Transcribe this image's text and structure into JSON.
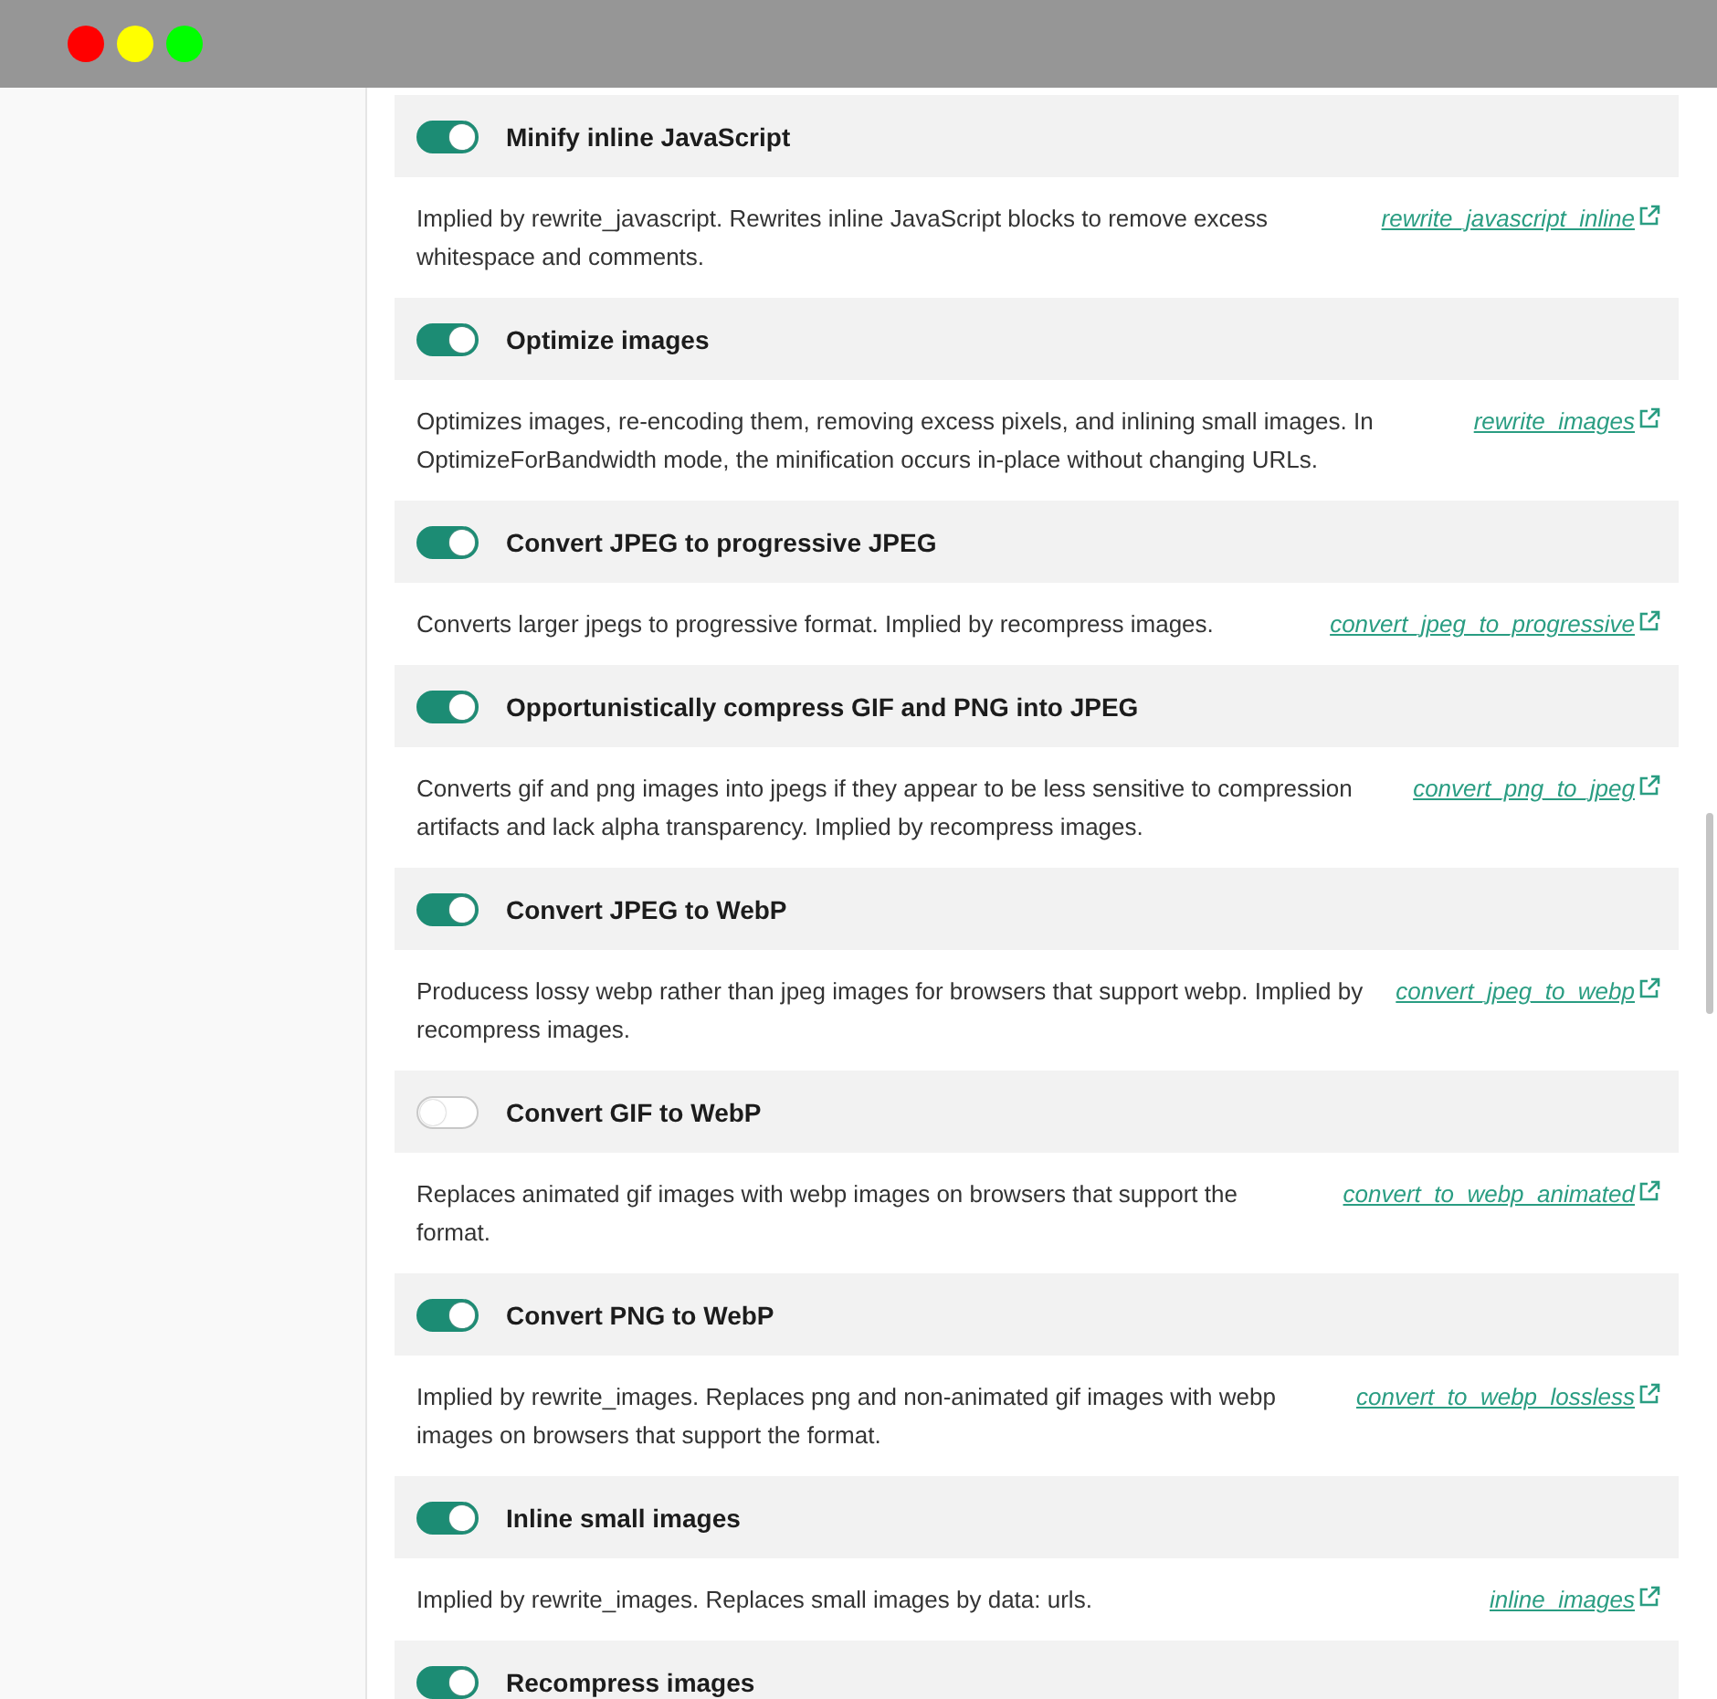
{
  "window": {
    "controls": [
      {
        "color": "#ff0000"
      },
      {
        "color": "#ffff00"
      },
      {
        "color": "#00ff00"
      }
    ]
  },
  "settings": [
    {
      "title": "Minify inline JavaScript",
      "on": true,
      "description": "Implied by rewrite_javascript. Rewrites inline JavaScript blocks to remove excess whitespace and comments.",
      "link": "rewrite_javascript_inline"
    },
    {
      "title": "Optimize images",
      "on": true,
      "description": "Optimizes images, re-encoding them, removing excess pixels, and inlining small images. In OptimizeForBandwidth mode, the minification occurs in-place without changing URLs.",
      "link": "rewrite_images"
    },
    {
      "title": "Convert JPEG to progressive JPEG",
      "on": true,
      "description": "Converts larger jpegs to progressive format. Implied by recompress images.",
      "link": "convert_jpeg_to_progressive"
    },
    {
      "title": "Opportunistically compress GIF and PNG into JPEG",
      "on": true,
      "description": "Converts gif and png images into jpegs if they appear to be less sensitive to compression artifacts and lack alpha transparency. Implied by recompress images.",
      "link": "convert_png_to_jpeg"
    },
    {
      "title": "Convert JPEG to WebP",
      "on": true,
      "description": "Producess lossy webp rather than jpeg images for browsers that support webp. Implied by recompress images.",
      "link": "convert_jpeg_to_webp"
    },
    {
      "title": "Convert GIF to WebP",
      "on": false,
      "description": "Replaces animated gif images with webp images on browsers that support the format.",
      "link": "convert_to_webp_animated"
    },
    {
      "title": "Convert PNG to WebP",
      "on": true,
      "description": "Implied by rewrite_images. Replaces png and non-animated gif images with webp images on browsers that support the format.",
      "link": "convert_to_webp_lossless"
    },
    {
      "title": "Inline small images",
      "on": true,
      "description": "Implied by rewrite_images. Replaces small images by data: urls.",
      "link": "inline_images"
    },
    {
      "title": "Recompress images",
      "on": true
    }
  ]
}
